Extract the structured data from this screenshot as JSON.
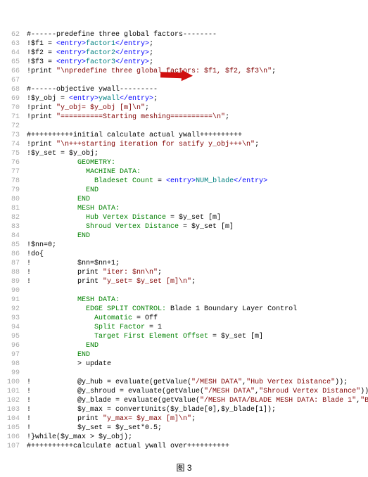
{
  "caption": "图 3",
  "chart_data": {
    "type": "code_listing"
  },
  "lines": [
    {
      "n": 62,
      "segs": [
        {
          "t": "#------predefine three global factors--------",
          "c": ""
        }
      ]
    },
    {
      "n": 63,
      "segs": [
        {
          "t": "!$f1 = ",
          "c": ""
        },
        {
          "t": "<entry>",
          "c": "blue"
        },
        {
          "t": "factor1",
          "c": "teal"
        },
        {
          "t": "</entry>",
          "c": "blue"
        },
        {
          "t": ";",
          "c": ""
        }
      ]
    },
    {
      "n": 64,
      "segs": [
        {
          "t": "!$f2 = ",
          "c": ""
        },
        {
          "t": "<entry>",
          "c": "blue"
        },
        {
          "t": "factor2",
          "c": "teal"
        },
        {
          "t": "</entry>",
          "c": "blue"
        },
        {
          "t": ";",
          "c": ""
        }
      ]
    },
    {
      "n": 65,
      "segs": [
        {
          "t": "!$f3 = ",
          "c": ""
        },
        {
          "t": "<entry>",
          "c": "blue"
        },
        {
          "t": "factor3",
          "c": "teal"
        },
        {
          "t": "</entry>",
          "c": "blue"
        },
        {
          "t": ";",
          "c": ""
        }
      ]
    },
    {
      "n": 66,
      "segs": [
        {
          "t": "!print ",
          "c": ""
        },
        {
          "t": "\"\\npredefine three global factors: $f1, $f2, $f3\\n\"",
          "c": "red"
        },
        {
          "t": ";",
          "c": ""
        }
      ]
    },
    {
      "n": 67,
      "segs": [
        {
          "t": "",
          "c": ""
        }
      ]
    },
    {
      "n": 68,
      "segs": [
        {
          "t": "#------objective ywall---------",
          "c": ""
        }
      ]
    },
    {
      "n": 69,
      "segs": [
        {
          "t": "!$y_obj = ",
          "c": ""
        },
        {
          "t": "<entry>",
          "c": "blue"
        },
        {
          "t": "ywall",
          "c": "teal"
        },
        {
          "t": "</entry>",
          "c": "blue"
        },
        {
          "t": ";",
          "c": ""
        }
      ]
    },
    {
      "n": 70,
      "segs": [
        {
          "t": "!print ",
          "c": ""
        },
        {
          "t": "\"y_obj= $y_obj [m]\\n\"",
          "c": "red"
        },
        {
          "t": ";",
          "c": ""
        }
      ]
    },
    {
      "n": 71,
      "segs": [
        {
          "t": "!print ",
          "c": ""
        },
        {
          "t": "\"==========Starting meshing==========\\n\"",
          "c": "red"
        },
        {
          "t": ";",
          "c": ""
        }
      ]
    },
    {
      "n": 72,
      "segs": [
        {
          "t": "",
          "c": ""
        }
      ]
    },
    {
      "n": 73,
      "segs": [
        {
          "t": "#++++++++++initial calculate actual ywall++++++++++",
          "c": ""
        }
      ]
    },
    {
      "n": 74,
      "segs": [
        {
          "t": "!print ",
          "c": ""
        },
        {
          "t": "\"\\n+++starting iteration for satify y_obj+++\\n\"",
          "c": "red"
        },
        {
          "t": ";",
          "c": ""
        }
      ]
    },
    {
      "n": 75,
      "segs": [
        {
          "t": "!$y_set = $y_obj;",
          "c": ""
        }
      ]
    },
    {
      "n": 76,
      "segs": [
        {
          "t": "            ",
          "c": ""
        },
        {
          "t": "GEOMETRY:",
          "c": "grn"
        }
      ]
    },
    {
      "n": 77,
      "segs": [
        {
          "t": "              ",
          "c": ""
        },
        {
          "t": "MACHINE DATA:",
          "c": "grn"
        }
      ]
    },
    {
      "n": 78,
      "segs": [
        {
          "t": "                ",
          "c": ""
        },
        {
          "t": "Bladeset Count",
          "c": "grn"
        },
        {
          "t": " = ",
          "c": ""
        },
        {
          "t": "<entry>",
          "c": "blue"
        },
        {
          "t": "NUM_blade",
          "c": "teal"
        },
        {
          "t": "</entry>",
          "c": "blue"
        }
      ]
    },
    {
      "n": 79,
      "segs": [
        {
          "t": "              ",
          "c": ""
        },
        {
          "t": "END",
          "c": "grn"
        }
      ]
    },
    {
      "n": 80,
      "segs": [
        {
          "t": "            ",
          "c": ""
        },
        {
          "t": "END",
          "c": "grn"
        }
      ]
    },
    {
      "n": 81,
      "segs": [
        {
          "t": "            ",
          "c": ""
        },
        {
          "t": "MESH DATA:",
          "c": "grn"
        }
      ]
    },
    {
      "n": 82,
      "segs": [
        {
          "t": "              ",
          "c": ""
        },
        {
          "t": "Hub Vertex Distance",
          "c": "grn"
        },
        {
          "t": " = $y_set [m]",
          "c": ""
        }
      ]
    },
    {
      "n": 83,
      "segs": [
        {
          "t": "              ",
          "c": ""
        },
        {
          "t": "Shroud Vertex Distance",
          "c": "grn"
        },
        {
          "t": " = $y_set [m]",
          "c": ""
        }
      ]
    },
    {
      "n": 84,
      "segs": [
        {
          "t": "            ",
          "c": ""
        },
        {
          "t": "END",
          "c": "grn"
        }
      ]
    },
    {
      "n": 85,
      "segs": [
        {
          "t": "!$nn=0;",
          "c": ""
        }
      ]
    },
    {
      "n": 86,
      "segs": [
        {
          "t": "!do{",
          "c": ""
        }
      ]
    },
    {
      "n": 87,
      "segs": [
        {
          "t": "!           $nn=$nn+1;",
          "c": ""
        }
      ]
    },
    {
      "n": 88,
      "segs": [
        {
          "t": "!           print ",
          "c": ""
        },
        {
          "t": "\"iter: $nn\\n\"",
          "c": "red"
        },
        {
          "t": ";",
          "c": ""
        }
      ]
    },
    {
      "n": 89,
      "segs": [
        {
          "t": "!           print ",
          "c": ""
        },
        {
          "t": "\"y_set= $y_set [m]\\n\"",
          "c": "red"
        },
        {
          "t": ";",
          "c": ""
        }
      ]
    },
    {
      "n": 90,
      "segs": [
        {
          "t": "",
          "c": ""
        }
      ]
    },
    {
      "n": 91,
      "segs": [
        {
          "t": "            ",
          "c": ""
        },
        {
          "t": "MESH DATA:",
          "c": "grn"
        }
      ]
    },
    {
      "n": 92,
      "segs": [
        {
          "t": "              ",
          "c": ""
        },
        {
          "t": "EDGE SPLIT CONTROL:",
          "c": "grn"
        },
        {
          "t": " Blade 1 Boundary Layer Control",
          "c": ""
        }
      ]
    },
    {
      "n": 93,
      "segs": [
        {
          "t": "                ",
          "c": ""
        },
        {
          "t": "Automatic",
          "c": "grn"
        },
        {
          "t": " = Off",
          "c": ""
        }
      ]
    },
    {
      "n": 94,
      "segs": [
        {
          "t": "                ",
          "c": ""
        },
        {
          "t": "Split Factor",
          "c": "grn"
        },
        {
          "t": " = 1",
          "c": ""
        }
      ]
    },
    {
      "n": 95,
      "segs": [
        {
          "t": "                ",
          "c": ""
        },
        {
          "t": "Target First Element Offset",
          "c": "grn"
        },
        {
          "t": " = $y_set [m]",
          "c": ""
        }
      ]
    },
    {
      "n": 96,
      "segs": [
        {
          "t": "              ",
          "c": ""
        },
        {
          "t": "END",
          "c": "grn"
        }
      ]
    },
    {
      "n": 97,
      "segs": [
        {
          "t": "            ",
          "c": ""
        },
        {
          "t": "END",
          "c": "grn"
        }
      ]
    },
    {
      "n": 98,
      "segs": [
        {
          "t": "            > update",
          "c": ""
        }
      ]
    },
    {
      "n": 99,
      "segs": [
        {
          "t": "",
          "c": ""
        }
      ]
    },
    {
      "n": 100,
      "segs": [
        {
          "t": "!           @y_hub = evaluate(getValue(",
          "c": ""
        },
        {
          "t": "\"/MESH DATA\"",
          "c": "red"
        },
        {
          "t": ",",
          "c": ""
        },
        {
          "t": "\"Hub Vertex Distance\"",
          "c": "red"
        },
        {
          "t": "));",
          "c": ""
        }
      ]
    },
    {
      "n": 101,
      "segs": [
        {
          "t": "!           @y_shroud = evaluate(getValue(",
          "c": ""
        },
        {
          "t": "\"/MESH DATA\"",
          "c": "red"
        },
        {
          "t": ",",
          "c": ""
        },
        {
          "t": "\"Shroud Vertex Distance\"",
          "c": "red"
        },
        {
          "t": "));",
          "c": ""
        }
      ]
    },
    {
      "n": 102,
      "segs": [
        {
          "t": "!           @y_blade = evaluate(getValue(",
          "c": ""
        },
        {
          "t": "\"/MESH DATA/BLADE MESH DATA: Blade 1\"",
          "c": "red"
        },
        {
          "t": ",",
          "c": ""
        },
        {
          "t": "\"Blade Vertex",
          "c": "red"
        }
      ]
    },
    {
      "n": 103,
      "segs": [
        {
          "t": "!           $y_max = convertUnits($y_blade[0],$y_blade[1]);",
          "c": ""
        }
      ]
    },
    {
      "n": 104,
      "segs": [
        {
          "t": "!           print ",
          "c": ""
        },
        {
          "t": "\"y_max= $y_max [m]\\n\"",
          "c": "red"
        },
        {
          "t": ";",
          "c": ""
        }
      ]
    },
    {
      "n": 105,
      "segs": [
        {
          "t": "!           $y_set = $y_set*0.5;",
          "c": ""
        }
      ]
    },
    {
      "n": 106,
      "segs": [
        {
          "t": "!}while($y_max > $y_obj);",
          "c": ""
        }
      ]
    },
    {
      "n": 107,
      "segs": [
        {
          "t": "#++++++++++calculate actual ywall over++++++++++",
          "c": ""
        }
      ]
    }
  ]
}
